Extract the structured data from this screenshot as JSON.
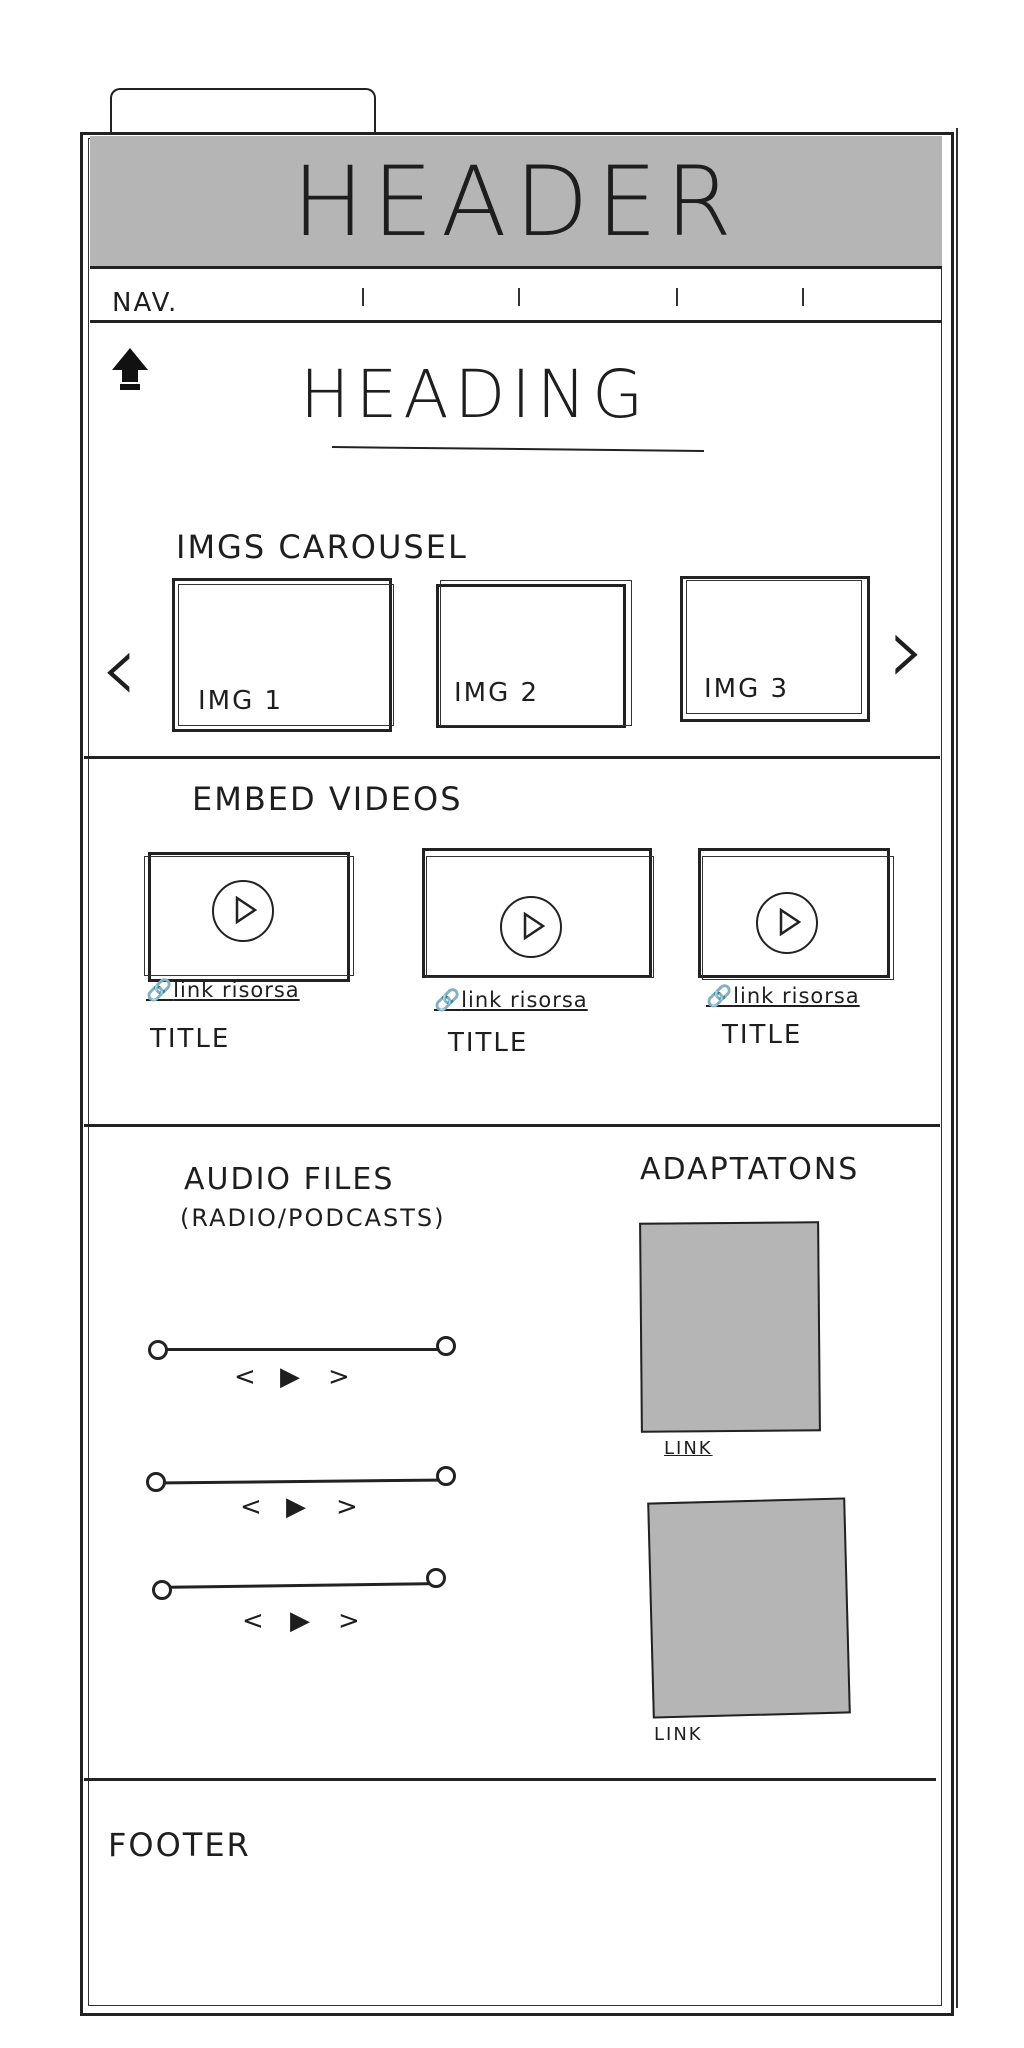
{
  "header": {
    "title": "HEADER"
  },
  "nav": {
    "label": "NAV."
  },
  "main": {
    "heading": "HEADING"
  },
  "carousel": {
    "label": "IMGS CAROUSEL",
    "images": [
      "IMG 1",
      "IMG 2",
      "IMG 3"
    ],
    "prev_icon": "chevron-left-icon",
    "next_icon": "chevron-right-icon",
    "prev_glyph": "‹",
    "next_glyph": "›"
  },
  "videos": {
    "label": "EMBED VIDEOS",
    "items": [
      {
        "link": "link risorsa",
        "title": "TITLE"
      },
      {
        "link": "link risorsa",
        "title": "TITLE"
      },
      {
        "link": "link risorsa",
        "title": "TITLE"
      }
    ]
  },
  "audio": {
    "label": "AUDIO FILES",
    "sublabel": "(RADIO/PODCASTS)",
    "prev_glyph": "<",
    "next_glyph": ">"
  },
  "adaptations": {
    "label": "ADAPTATONS",
    "items": [
      {
        "link": "LINK"
      },
      {
        "link": "LINK"
      }
    ]
  },
  "footer": {
    "label": "FOOTER"
  },
  "colors": {
    "fill_gray": "#b5b5b5",
    "stroke": "#222222"
  }
}
